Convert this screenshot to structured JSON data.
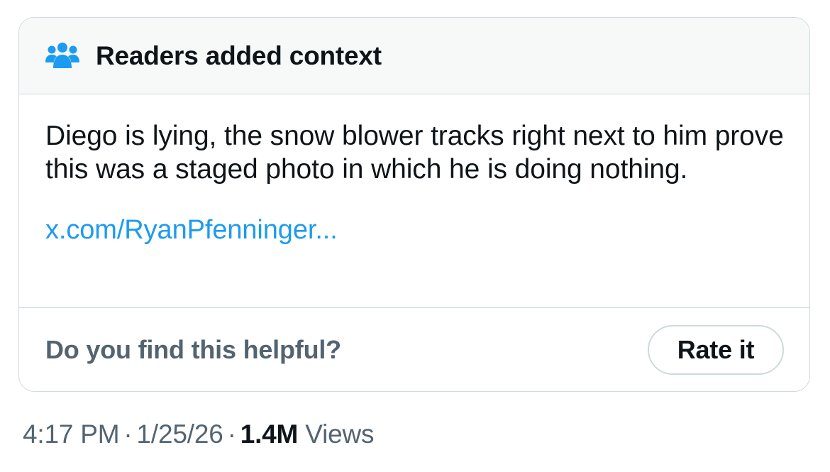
{
  "note": {
    "header_title": "Readers added context",
    "header_icon": "people-group-icon",
    "body_text": "Diego is lying, the snow blower tracks right next to him prove this was a staged photo in which he is doing nothing.",
    "link_text": "x.com/RyanPfenninger...",
    "footer_question": "Do you find this helpful?",
    "rate_button_label": "Rate it"
  },
  "meta": {
    "time": "4:17 PM",
    "separator": "·",
    "date": "1/25/26",
    "views_count": "1.4M",
    "views_label": "Views"
  },
  "colors": {
    "accent": "#1d9bf0",
    "header_bg": "#f7f9f9",
    "border": "#cfd9de",
    "text_primary": "#0f1419",
    "text_secondary": "#536471"
  }
}
